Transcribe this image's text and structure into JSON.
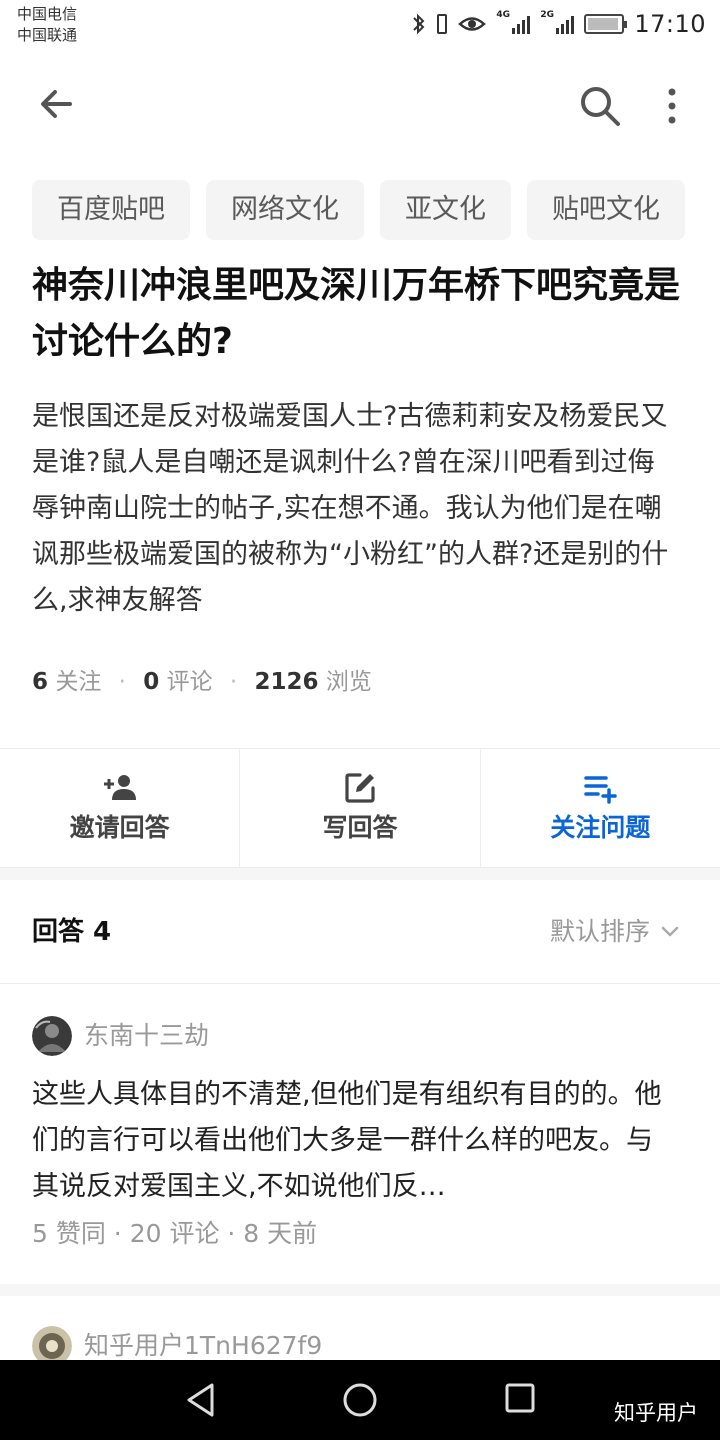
{
  "status_bar": {
    "carrier_1": "中国电信",
    "carrier_2": "中国联通",
    "network_1": "4G",
    "network_2": "2G",
    "time": "17:10"
  },
  "header": {
    "back_icon": "arrow-left-icon",
    "search_icon": "search-icon",
    "more_icon": "more-vertical-icon"
  },
  "topics": [
    "百度贴吧",
    "网络文化",
    "亚文化",
    "贴吧文化"
  ],
  "question": {
    "title": "神奈川冲浪里吧及深川万年桥下吧究竟是讨论什么的?",
    "description": "是恨国还是反对极端爱国人士?古德莉莉安及杨爱民又是谁?鼠人是自嘲还是讽刺什么?曾在深川吧看到过侮辱钟南山院士的帖子,实在想不通。我认为他们是在嘲讽那些极端爱国的被称为“小粉红”的人群?还是别的什么,求神友解答"
  },
  "stats": {
    "follow_count": "6",
    "follow_label": "关注",
    "comment_count": "0",
    "comment_label": "评论",
    "view_count": "2126",
    "view_label": "浏览"
  },
  "actions": {
    "invite_label": "邀请回答",
    "write_label": "写回答",
    "follow_label": "关注问题"
  },
  "answers_section": {
    "title": "回答 4",
    "sort_label": "默认排序"
  },
  "answers": [
    {
      "author": "东南十三劫",
      "text": "这些人具体目的不清楚,但他们是有组织有目的的。他们的言行可以看出他们大多是一群什么样的吧友。与其说反对爱国主义,不如说他们反…",
      "meta": "5 赞同 · 20 评论 · 8 天前"
    },
    {
      "author": "知乎用户1TnH627f9"
    }
  ],
  "navbar": {
    "watermark": "知乎用户"
  },
  "colors": {
    "accent": "#0a66d8",
    "chip_bg": "#f4f4f4",
    "muted_text": "#999999"
  }
}
